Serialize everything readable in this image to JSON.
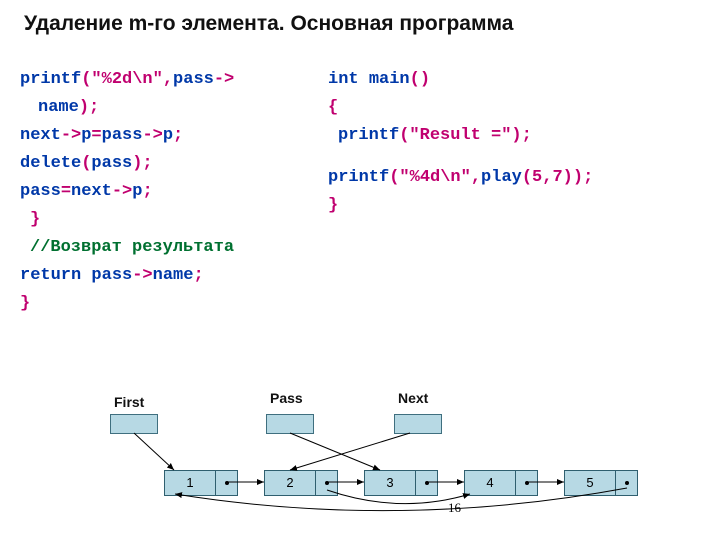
{
  "title": "Удаление m-го элемента. Основная программа",
  "leftCode": {
    "l1a": "printf",
    "l1b": "(\"%2d\\n\",",
    "l1c": "pass",
    "l1d": "->",
    "l2a": "name",
    "l2b": ");",
    "l3a": "next",
    "l3b": "->",
    "l3c": "p",
    "l3d": "=",
    "l3e": "pass",
    "l3f": "->",
    "l3g": "p",
    "l3h": ";",
    "l4a": "delete",
    "l4b": "(",
    "l4c": "pass",
    "l4d": ");",
    "l5a": "pass",
    "l5b": "=",
    "l5c": "next",
    "l5d": "->",
    "l5e": "p",
    "l5f": ";",
    "l6": "}",
    "l7": "//Возврат результата",
    "l8a": "return",
    "l8b": "pass",
    "l8c": "->",
    "l8d": "name",
    "l8e": ";",
    "l9": "}"
  },
  "rightCode": {
    "r1a": "int",
    "r1b": "main",
    "r1c": "()",
    "r2": "{",
    "r3a": "printf",
    "r3b": "(\"Result =\");",
    "r4a": "printf",
    "r4b": "(\"%4d\\n\",",
    "r4c": "play",
    "r4d": "(5,7));",
    "r5": "}"
  },
  "diagram": {
    "labels": {
      "first": "First",
      "pass": "Pass",
      "next": "Next"
    },
    "nodes": [
      "1",
      "2",
      "3",
      "4",
      "5"
    ]
  },
  "pageNumber": "16"
}
